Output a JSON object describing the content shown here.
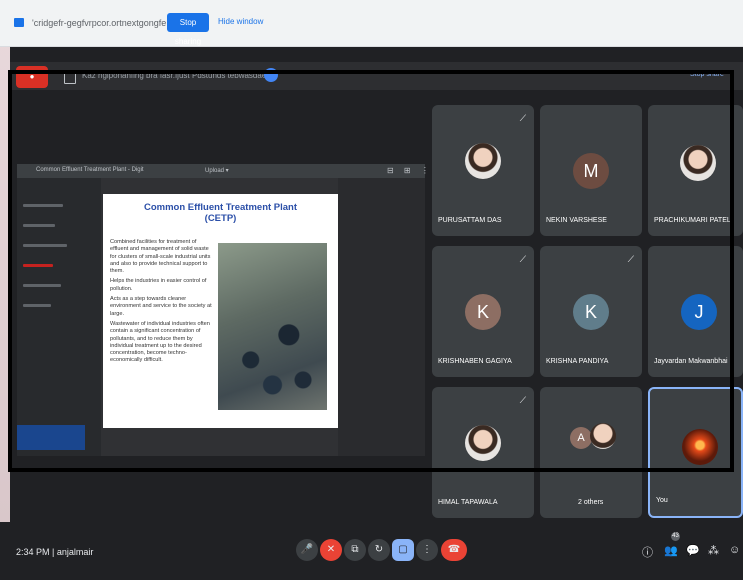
{
  "share_banner": {
    "text": "'cridgefr-gegfvrpcor.ortnextgongfe.cnm",
    "stop_label": "Stop sharing",
    "hide_label": "Hide window"
  },
  "top_bar": {
    "red_chip": "●",
    "tab_title": "Kaz hglponanflng bra fasr.fjust",
    "tab_sub": "Pdstunds tebwasdae",
    "right_text": "Stop share"
  },
  "screen": {
    "bar_title": "Common Effluent Treatment Plant - Digit",
    "bar_mid": "Upload ▾",
    "bar_icons": "⊟ ⊞ ⋮"
  },
  "slide": {
    "title_line1": "Common Effluent Treatment Plant",
    "title_line2": "(CETP)",
    "bullets": [
      "Combined facilities for treatment of effluent and management of solid waste for clusters of small-scale industrial units and also to provide technical support to them.",
      "Helps the industries in easier control of pollution.",
      "Acts as a step towards cleaner environment and service to the society at large.",
      "Wastewater of individual industries often contain a significant concentration of pollutants, and to reduce them by individual treatment up to the desired concentration, become techno-economically difficult."
    ]
  },
  "participants": [
    {
      "name": "PURUSATTAM DAS",
      "type": "photo",
      "muted": true
    },
    {
      "name": "NEKIN VARSHESE",
      "type": "avatar",
      "initial": "M",
      "color": "#6d4c41",
      "muted": false
    },
    {
      "name": "PRACHIKUMARI PATEL",
      "type": "photo",
      "muted": false
    },
    {
      "name": "KRISHNABEN GAGIYA",
      "type": "avatar",
      "initial": "K",
      "color": "#8d6e63",
      "muted": true
    },
    {
      "name": "KRISHNA PANDIYA",
      "type": "avatar",
      "initial": "K",
      "color": "#607d8b",
      "muted": true
    },
    {
      "name": "Jayvardan Makwanbhai",
      "type": "avatar",
      "initial": "J",
      "color": "#1565c0",
      "muted": false
    },
    {
      "name": "HIMAL TAPAWALA",
      "type": "photo",
      "muted": true
    },
    {
      "name": "2 others",
      "type": "group",
      "initial": "A",
      "muted": false
    },
    {
      "name": "You",
      "type": "self",
      "muted": false
    }
  ],
  "bottom": {
    "time_label": "2:34 PM  |  anjalmair",
    "controls": [
      "🎤",
      "✕",
      "⧉",
      "↻",
      "▢",
      "⋮",
      "☎"
    ],
    "right_controls": [
      "ⓘ",
      "👥",
      "💬",
      "⁂",
      "☺"
    ],
    "participant_count": "43"
  }
}
